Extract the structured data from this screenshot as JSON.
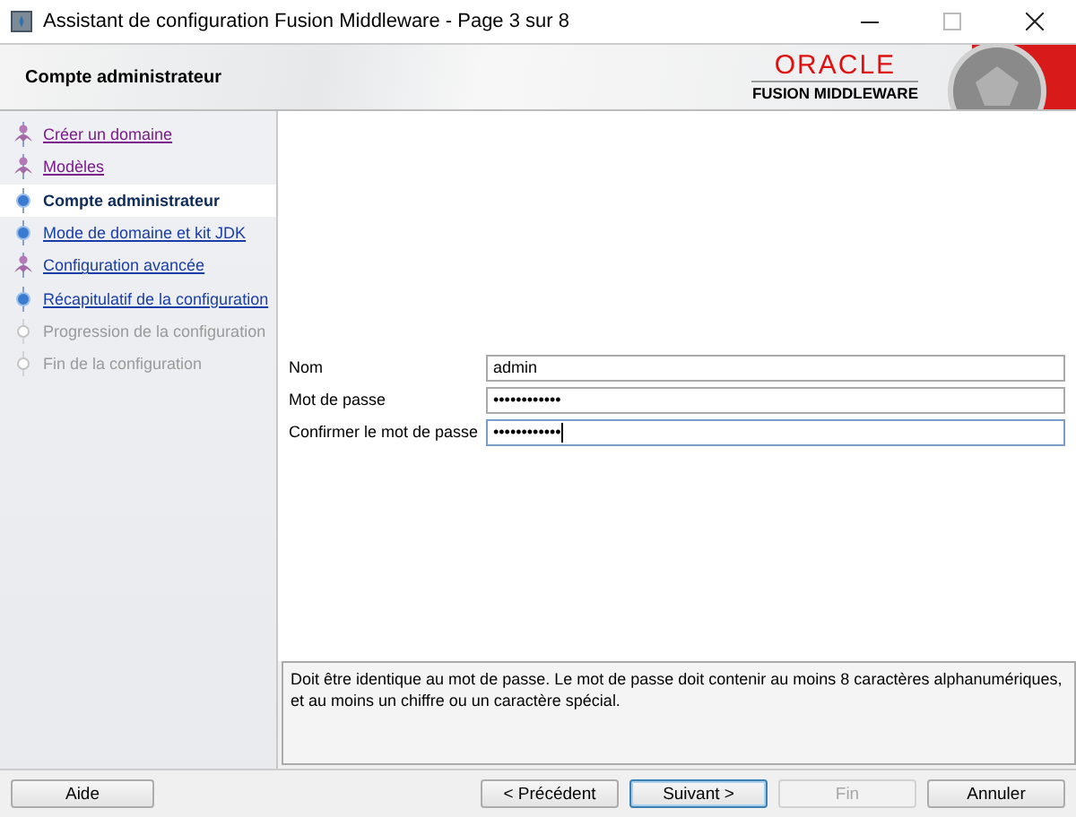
{
  "window": {
    "title": "Assistant de configuration Fusion Middleware - Page 3 sur 8"
  },
  "header": {
    "title": "Compte administrateur",
    "brand": "ORACLE",
    "product": "FUSION MIDDLEWARE"
  },
  "steps": [
    {
      "label": "Créer un domaine",
      "selected": false,
      "visited": true,
      "disabled": false,
      "kind": "figure"
    },
    {
      "label": "Modèles",
      "selected": false,
      "visited": true,
      "disabled": false,
      "kind": "figure"
    },
    {
      "label": "Compte administrateur",
      "selected": true,
      "visited": false,
      "disabled": false,
      "kind": "dot"
    },
    {
      "label": "Mode de domaine et kit JDK",
      "selected": false,
      "visited": false,
      "disabled": false,
      "kind": "dot"
    },
    {
      "label": "Configuration avancée",
      "selected": false,
      "visited": false,
      "disabled": false,
      "kind": "figure"
    },
    {
      "label": "Récapitulatif de la configuration",
      "selected": false,
      "visited": false,
      "disabled": false,
      "kind": "dot"
    },
    {
      "label": "Progression de la configuration",
      "selected": false,
      "visited": false,
      "disabled": true,
      "kind": "ring"
    },
    {
      "label": "Fin de la configuration",
      "selected": false,
      "visited": false,
      "disabled": true,
      "kind": "ring"
    }
  ],
  "fields": [
    {
      "label": "Nom",
      "value": "admin",
      "focused": false
    },
    {
      "label": "Mot de passe",
      "value": "••••••••••••",
      "focused": false
    },
    {
      "label": "Confirmer le mot de passe",
      "value": "••••••••••••",
      "focused": true
    }
  ],
  "message": "Doit être identique au mot de passe. Le mot de passe doit contenir au moins 8 caractères alphanumériques, et au moins un chiffre ou un caractère spécial.",
  "help_button": {
    "label": "Aide"
  },
  "buttons": [
    {
      "label": "< Précédent",
      "disabled": false,
      "default": false
    },
    {
      "label": "Suivant >",
      "disabled": false,
      "default": true
    },
    {
      "label": "Fin",
      "disabled": true,
      "default": false
    },
    {
      "label": "Annuler",
      "disabled": false,
      "default": false
    }
  ]
}
